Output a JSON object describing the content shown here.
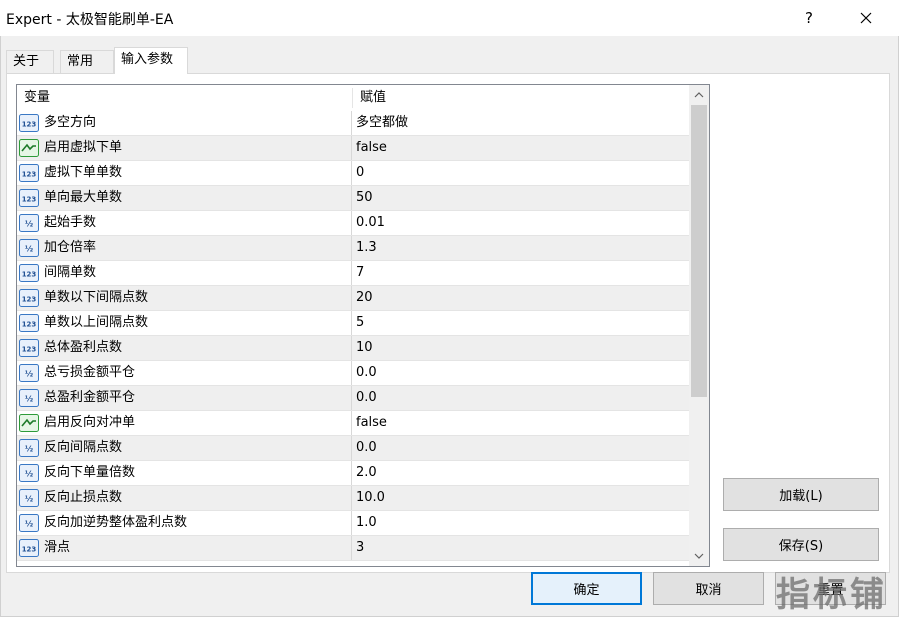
{
  "window": {
    "title": "Expert - 太极智能刷单-EA",
    "help_label": "?"
  },
  "tabs": [
    {
      "label": "关于",
      "active": false
    },
    {
      "label": "常用",
      "active": false
    },
    {
      "label": "输入参数",
      "active": true
    }
  ],
  "grid": {
    "columns": [
      "变量",
      "赋值"
    ],
    "rows": [
      {
        "icon": "int-icon",
        "name": "多空方向",
        "value": "多空都做"
      },
      {
        "icon": "bool-icon",
        "name": "启用虚拟下单",
        "value": "false"
      },
      {
        "icon": "int-icon",
        "name": "虚拟下单单数",
        "value": "0"
      },
      {
        "icon": "int-icon",
        "name": "单向最大单数",
        "value": "50"
      },
      {
        "icon": "double-icon",
        "name": "起始手数",
        "value": "0.01"
      },
      {
        "icon": "double-icon",
        "name": "加仓倍率",
        "value": "1.3"
      },
      {
        "icon": "int-icon",
        "name": "间隔单数",
        "value": "7"
      },
      {
        "icon": "int-icon",
        "name": "单数以下间隔点数",
        "value": "20"
      },
      {
        "icon": "int-icon",
        "name": "单数以上间隔点数",
        "value": "5"
      },
      {
        "icon": "int-icon",
        "name": "总体盈利点数",
        "value": "10"
      },
      {
        "icon": "double-icon",
        "name": "总亏损金额平仓",
        "value": "0.0"
      },
      {
        "icon": "double-icon",
        "name": "总盈利金额平仓",
        "value": "0.0"
      },
      {
        "icon": "bool-icon",
        "name": "启用反向对冲单",
        "value": "false"
      },
      {
        "icon": "double-icon",
        "name": "反向间隔点数",
        "value": "0.0"
      },
      {
        "icon": "double-icon",
        "name": "反向下单量倍数",
        "value": "2.0"
      },
      {
        "icon": "double-icon",
        "name": "反向止损点数",
        "value": "10.0"
      },
      {
        "icon": "double-icon",
        "name": "反向加逆势整体盈利点数",
        "value": "1.0"
      },
      {
        "icon": "int-icon",
        "name": "滑点",
        "value": "3"
      }
    ]
  },
  "buttons": {
    "load": "加载(L)",
    "save": "保存(S)",
    "ok": "确定",
    "cancel": "取消",
    "reset": "重置"
  },
  "watermark": "指标铺",
  "colors": {
    "accent": "#0078d7",
    "int_icon": "#3a78c4",
    "bool_icon": "#2e9b3a",
    "double_icon": "#3a78c4"
  }
}
